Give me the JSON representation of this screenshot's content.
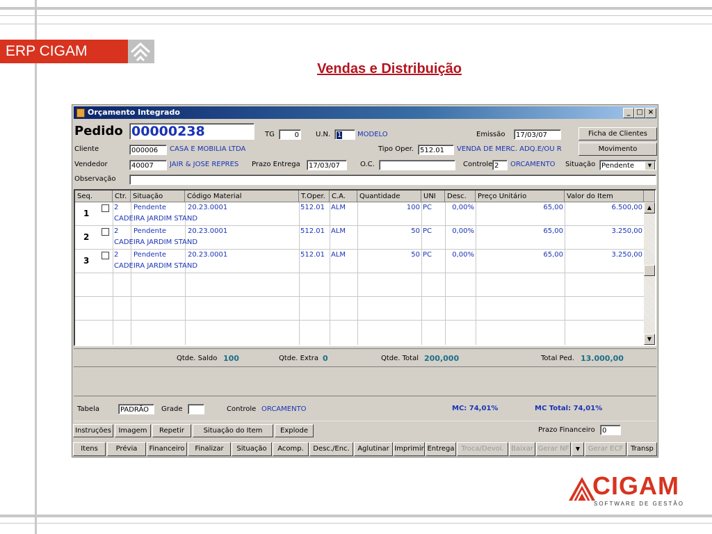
{
  "slide": {
    "brand_label": "ERP CIGAM",
    "title": "Vendas e Distribuição",
    "logo_text": "CIGAM",
    "logo_subtitle": "SOFTWARE DE GESTÃO",
    "brand_color": "#d8331f"
  },
  "window": {
    "title": "Orçamento Integrado",
    "controls": [
      "_",
      "□",
      "×"
    ]
  },
  "header": {
    "pedido_label": "Pedido",
    "pedido_number": "00000238",
    "tg_label": "TG",
    "tg_value": "0",
    "un_label": "U.N.",
    "un_value": "1",
    "un_name": "MODELO",
    "emissao_label": "Emissão",
    "emissao_value": "17/03/07",
    "ficha_button": "Ficha de Clientes",
    "movimento_button": "Movimento",
    "cliente_label": "Cliente",
    "cliente_code": "000006",
    "cliente_name": "CASA E  MOBILIA LTDA",
    "tipo_oper_label": "Tipo Oper.",
    "tipo_oper_value": "512.01",
    "tipo_oper_name": "VENDA DE MERC. ADQ.E/OU R",
    "vendedor_label": "Vendedor",
    "vendedor_code": "40007",
    "vendedor_name": "JAIR & JOSE REPRES",
    "prazo_entrega_label": "Prazo Entrega",
    "prazo_entrega_value": "17/03/07",
    "oc_label": "O.C.",
    "oc_value": "",
    "controle_label": "Controle",
    "controle_value": "2",
    "controle_name": "ORCAMENTO",
    "situacao_label": "Situação",
    "situacao_value": "Pendente",
    "observacao_label": "Observação",
    "observacao_value": ""
  },
  "grid": {
    "columns": [
      "Seq.",
      "Ctr.",
      "Situação",
      "Código Material",
      "T.Oper.",
      "C.A.",
      "Quantidade",
      "UNI",
      "Desc.",
      "Preço Unitário",
      "Valor do Item"
    ],
    "rows": [
      {
        "seq": "1",
        "ctr": "2",
        "situacao": "Pendente",
        "codigo": "20.23.0001",
        "toper": "512.01",
        "ca": "ALM",
        "qtd": "100",
        "uni": "PC",
        "desc": "0,00%",
        "preco": "65,00",
        "valor": "6.500,00",
        "descricao": "CADEIRA JARDIM  STAND"
      },
      {
        "seq": "2",
        "ctr": "2",
        "situacao": "Pendente",
        "codigo": "20.23.0001",
        "toper": "512.01",
        "ca": "ALM",
        "qtd": "50",
        "uni": "PC",
        "desc": "0,00%",
        "preco": "65,00",
        "valor": "3.250,00",
        "descricao": "CADEIRA JARDIM  STAND"
      },
      {
        "seq": "3",
        "ctr": "2",
        "situacao": "Pendente",
        "codigo": "20.23.0001",
        "toper": "512.01",
        "ca": "ALM",
        "qtd": "50",
        "uni": "PC",
        "desc": "0,00%",
        "preco": "65,00",
        "valor": "3.250,00",
        "descricao": "CADEIRA JARDIM  STAND"
      }
    ]
  },
  "totals": {
    "saldo_label": "Qtde. Saldo",
    "saldo_value": "100",
    "extra_label": "Qtde. Extra",
    "extra_value": "0",
    "total_label": "Qtde. Total",
    "total_value": "200,000",
    "total_ped_label": "Total Ped.",
    "total_ped_value": "13.000,00"
  },
  "footer": {
    "tabela_label": "Tabela",
    "tabela_value": "PADRÃO",
    "grade_label": "Grade",
    "grade_value": "",
    "controle_label": "Controle",
    "controle_value": "ORCAMENTO",
    "mc": "MC: 74,01%",
    "mc_total": "MC Total: 74,01%",
    "prazo_fin_label": "Prazo Financeiro",
    "prazo_fin_value": "0"
  },
  "actions": [
    "Instruções",
    "Imagem",
    "Repetir",
    "Situação do Item",
    "Explode"
  ],
  "tabs": [
    {
      "label": "Itens",
      "enabled": true
    },
    {
      "label": "Prévia",
      "enabled": true
    },
    {
      "label": "Financeiro",
      "enabled": true
    },
    {
      "label": "Finalizar",
      "enabled": true
    },
    {
      "label": "Situação",
      "enabled": true
    },
    {
      "label": "Acomp.",
      "enabled": true
    },
    {
      "label": "Desc./Enc.",
      "enabled": true
    },
    {
      "label": "Aglutinar",
      "enabled": true
    },
    {
      "label": "Imprimir",
      "enabled": true
    },
    {
      "label": "Entrega",
      "enabled": true
    },
    {
      "label": "Troca/Devol.",
      "enabled": false
    },
    {
      "label": "Baixar",
      "enabled": false
    },
    {
      "label": "Gerar NF",
      "enabled": false
    },
    {
      "label": "Gerar ECF",
      "enabled": false
    },
    {
      "label": "Transp",
      "enabled": true
    }
  ]
}
